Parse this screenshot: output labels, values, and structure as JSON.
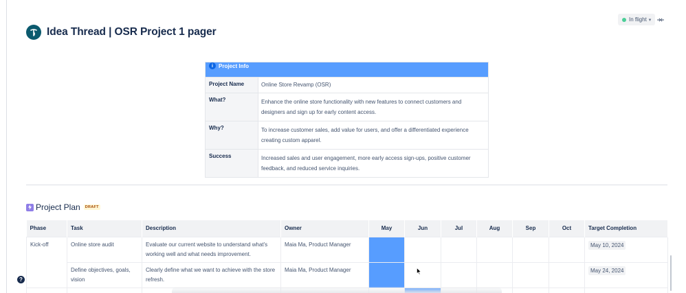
{
  "page": {
    "title": "Idea Thread | OSR Project 1 pager",
    "status": "In flight",
    "status_color": "#4bce97"
  },
  "info_table": {
    "header": "Project Info",
    "rows": [
      {
        "label": "Project Name",
        "value": "Online Store Revamp (OSR)"
      },
      {
        "label": "What?",
        "value": "Enhance the online store functionality with new features to connect customers and designers and sign up for early content access."
      },
      {
        "label": "Why?",
        "value": "To increase customer sales, add value for users, and offer a differentiated experience creating custom apparel."
      },
      {
        "label": "Success",
        "value": "Increased sales and user engagement, more early access sign-ups, positive customer feedback, and reduced service inquiries."
      }
    ]
  },
  "plan": {
    "title": "Project Plan",
    "badge": "DRAFT",
    "columns": [
      "Phase",
      "Task",
      "Description",
      "Owner",
      "May",
      "Jun",
      "Jul",
      "Aug",
      "Sep",
      "Oct",
      "Target Completion"
    ],
    "rows": [
      {
        "phase": "Kick-off",
        "task": "Online store audit",
        "description": "Evaluate our current website to understand what's working well and what needs improvement.",
        "owner": "Maia Ma, Product Manager",
        "active_months": [
          "May"
        ],
        "target": "May 10, 2024"
      },
      {
        "phase": "",
        "task": "Define objectives, goals, vision",
        "description": "Clearly define what we want to achieve with the store refresh.",
        "owner": "Maia Ma, Product Manager",
        "active_months": [
          "May"
        ],
        "target": "May 24, 2024"
      }
    ]
  },
  "colors": {
    "accent": "#579dff",
    "page_icon": "#0b5a6e"
  },
  "icons": {
    "page": "page-emoji-icon",
    "info": "info-icon",
    "plan": "plan-icon",
    "help": "help-icon",
    "expand": "expand-icon"
  }
}
